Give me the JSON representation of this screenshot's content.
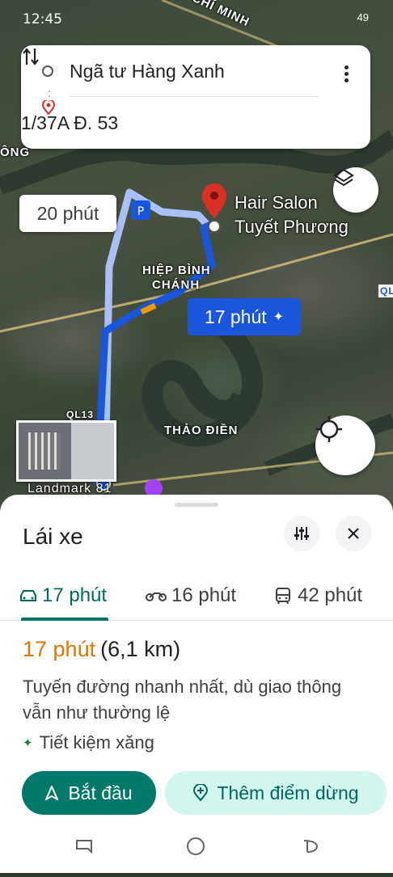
{
  "status_bar": {
    "time": "12:45",
    "right_info": "49"
  },
  "directions": {
    "origin": "Ngã tư Hàng Xanh",
    "destination": "1/37A Đ. 53"
  },
  "map": {
    "labels": {
      "chi_minh": "CHÍ MINH",
      "ong": "ÔNG",
      "hiep_binh_chanh_1": "HIỆP BÌNH",
      "hiep_binh_chanh_2": "CHÁNH",
      "thao_dien": "THẢO ĐIỀN",
      "ql13": "QL13",
      "landmark": "Landmark 81",
      "ql_right": "QL"
    },
    "alt_route_time": "20 phút",
    "main_route_time": "17 phút",
    "destination_name_line1": "Hair Salon",
    "destination_name_line2": "Tuyết Phương",
    "route_color": "#1a56db",
    "alt_route_color": "#a8c0f5"
  },
  "sheet": {
    "title": "Lái xe",
    "tabs": [
      {
        "mode": "car",
        "label": "17 phút"
      },
      {
        "mode": "motorbike",
        "label": "16 phút"
      },
      {
        "mode": "transit",
        "label": "42 phút"
      }
    ],
    "route_time": "17 phút",
    "route_distance": "(6,1 km)",
    "route_description": "Tuyến đường nhanh nhất, dù giao thông vẫn như thường lệ",
    "eco_label": "Tiết kiệm xăng",
    "start_label": "Bắt đầu",
    "add_stop_label": "Thêm điểm dừng"
  },
  "colors": {
    "accent": "#00796b",
    "time_orange": "#e37400",
    "blue_route": "#1a56db"
  }
}
